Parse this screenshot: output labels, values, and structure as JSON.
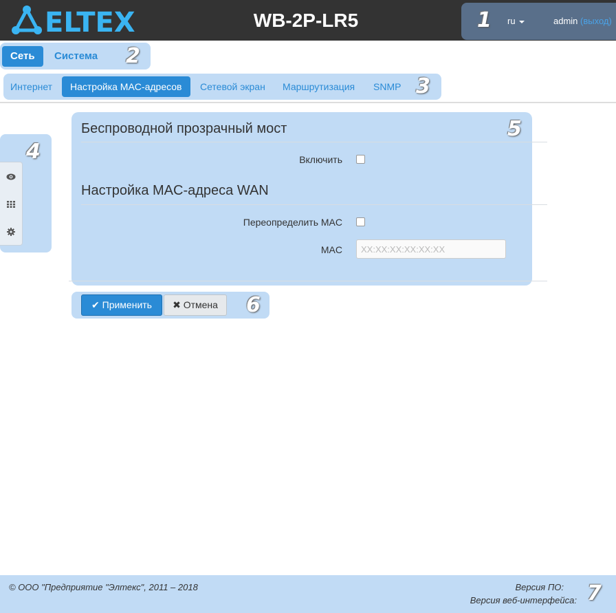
{
  "header": {
    "brand": "ELTEX",
    "device_title": "WB-2P-LR5",
    "language": "ru",
    "user": "admin",
    "logout_label": "(выход)"
  },
  "main_nav": [
    {
      "label": "Сеть",
      "active": true
    },
    {
      "label": "Система",
      "active": false
    }
  ],
  "sub_nav": [
    {
      "label": "Интернет",
      "active": false
    },
    {
      "label": "Настройка MAC-адресов",
      "active": true
    },
    {
      "label": "Сетевой экран",
      "active": false
    },
    {
      "label": "Маршрутизация",
      "active": false
    },
    {
      "label": "SNMP",
      "active": false
    }
  ],
  "side_tools": [
    {
      "icon": "eye-icon"
    },
    {
      "icon": "grid-icon"
    },
    {
      "icon": "gear-icon"
    }
  ],
  "form": {
    "section1_title": "Беспроводной прозрачный мост",
    "enable_label": "Включить",
    "enable_checked": false,
    "section2_title": "Настройка MAC-адреса WAN",
    "override_label": "Переопределить MAC",
    "override_checked": false,
    "mac_label": "MAC",
    "mac_placeholder": "XX:XX:XX:XX:XX:XX"
  },
  "buttons": {
    "apply_label": "Применить",
    "cancel_label": "Отмена"
  },
  "footer": {
    "copyright": "© ООО \"Предприятие \"Элтекс\", 2011 – 2018",
    "fw_version_label": "Версия ПО:",
    "web_version_label": "Версия веб-интерфейса:"
  },
  "callouts": [
    "1",
    "2",
    "3",
    "4",
    "5",
    "6",
    "7"
  ],
  "colors": {
    "header_bg": "#333333",
    "accent": "#2a8bd6",
    "logo": "#3ab4f2",
    "highlight": "#a0c8f0"
  }
}
